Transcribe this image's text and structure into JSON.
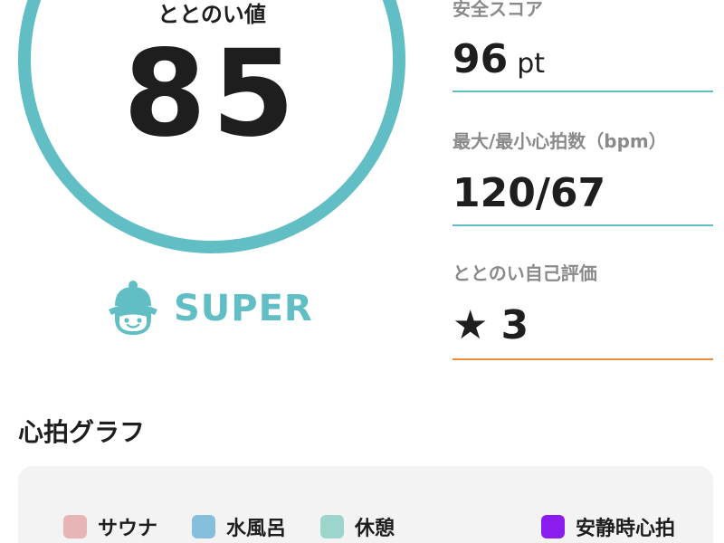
{
  "score": {
    "label": "ととのい値",
    "value": "85",
    "ring_color": "#61bec4"
  },
  "rank": {
    "icon": "sauna-hat-mascot-icon",
    "label": "SUPER"
  },
  "stats": {
    "safety": {
      "label": "安全スコア",
      "value": "96",
      "unit": "pt",
      "line_color": "#61bec4"
    },
    "heart_rate": {
      "label": "最大/最小心拍数（bpm）",
      "value": "120/67",
      "line_color": "#61bec4"
    },
    "self_rating": {
      "label": "ととのい自己評価",
      "icon": "star-icon",
      "star": "★",
      "value": "3",
      "line_color": "#ee8d3c"
    }
  },
  "graph": {
    "title": "心拍グラフ",
    "legend": [
      {
        "label": "サウナ",
        "color": "#e8b5b7"
      },
      {
        "label": "水風呂",
        "color": "#85bfdc"
      },
      {
        "label": "休憩",
        "color": "#9bd5cb"
      },
      {
        "label": "安静時心拍",
        "color": "#8a1cf0"
      }
    ]
  }
}
